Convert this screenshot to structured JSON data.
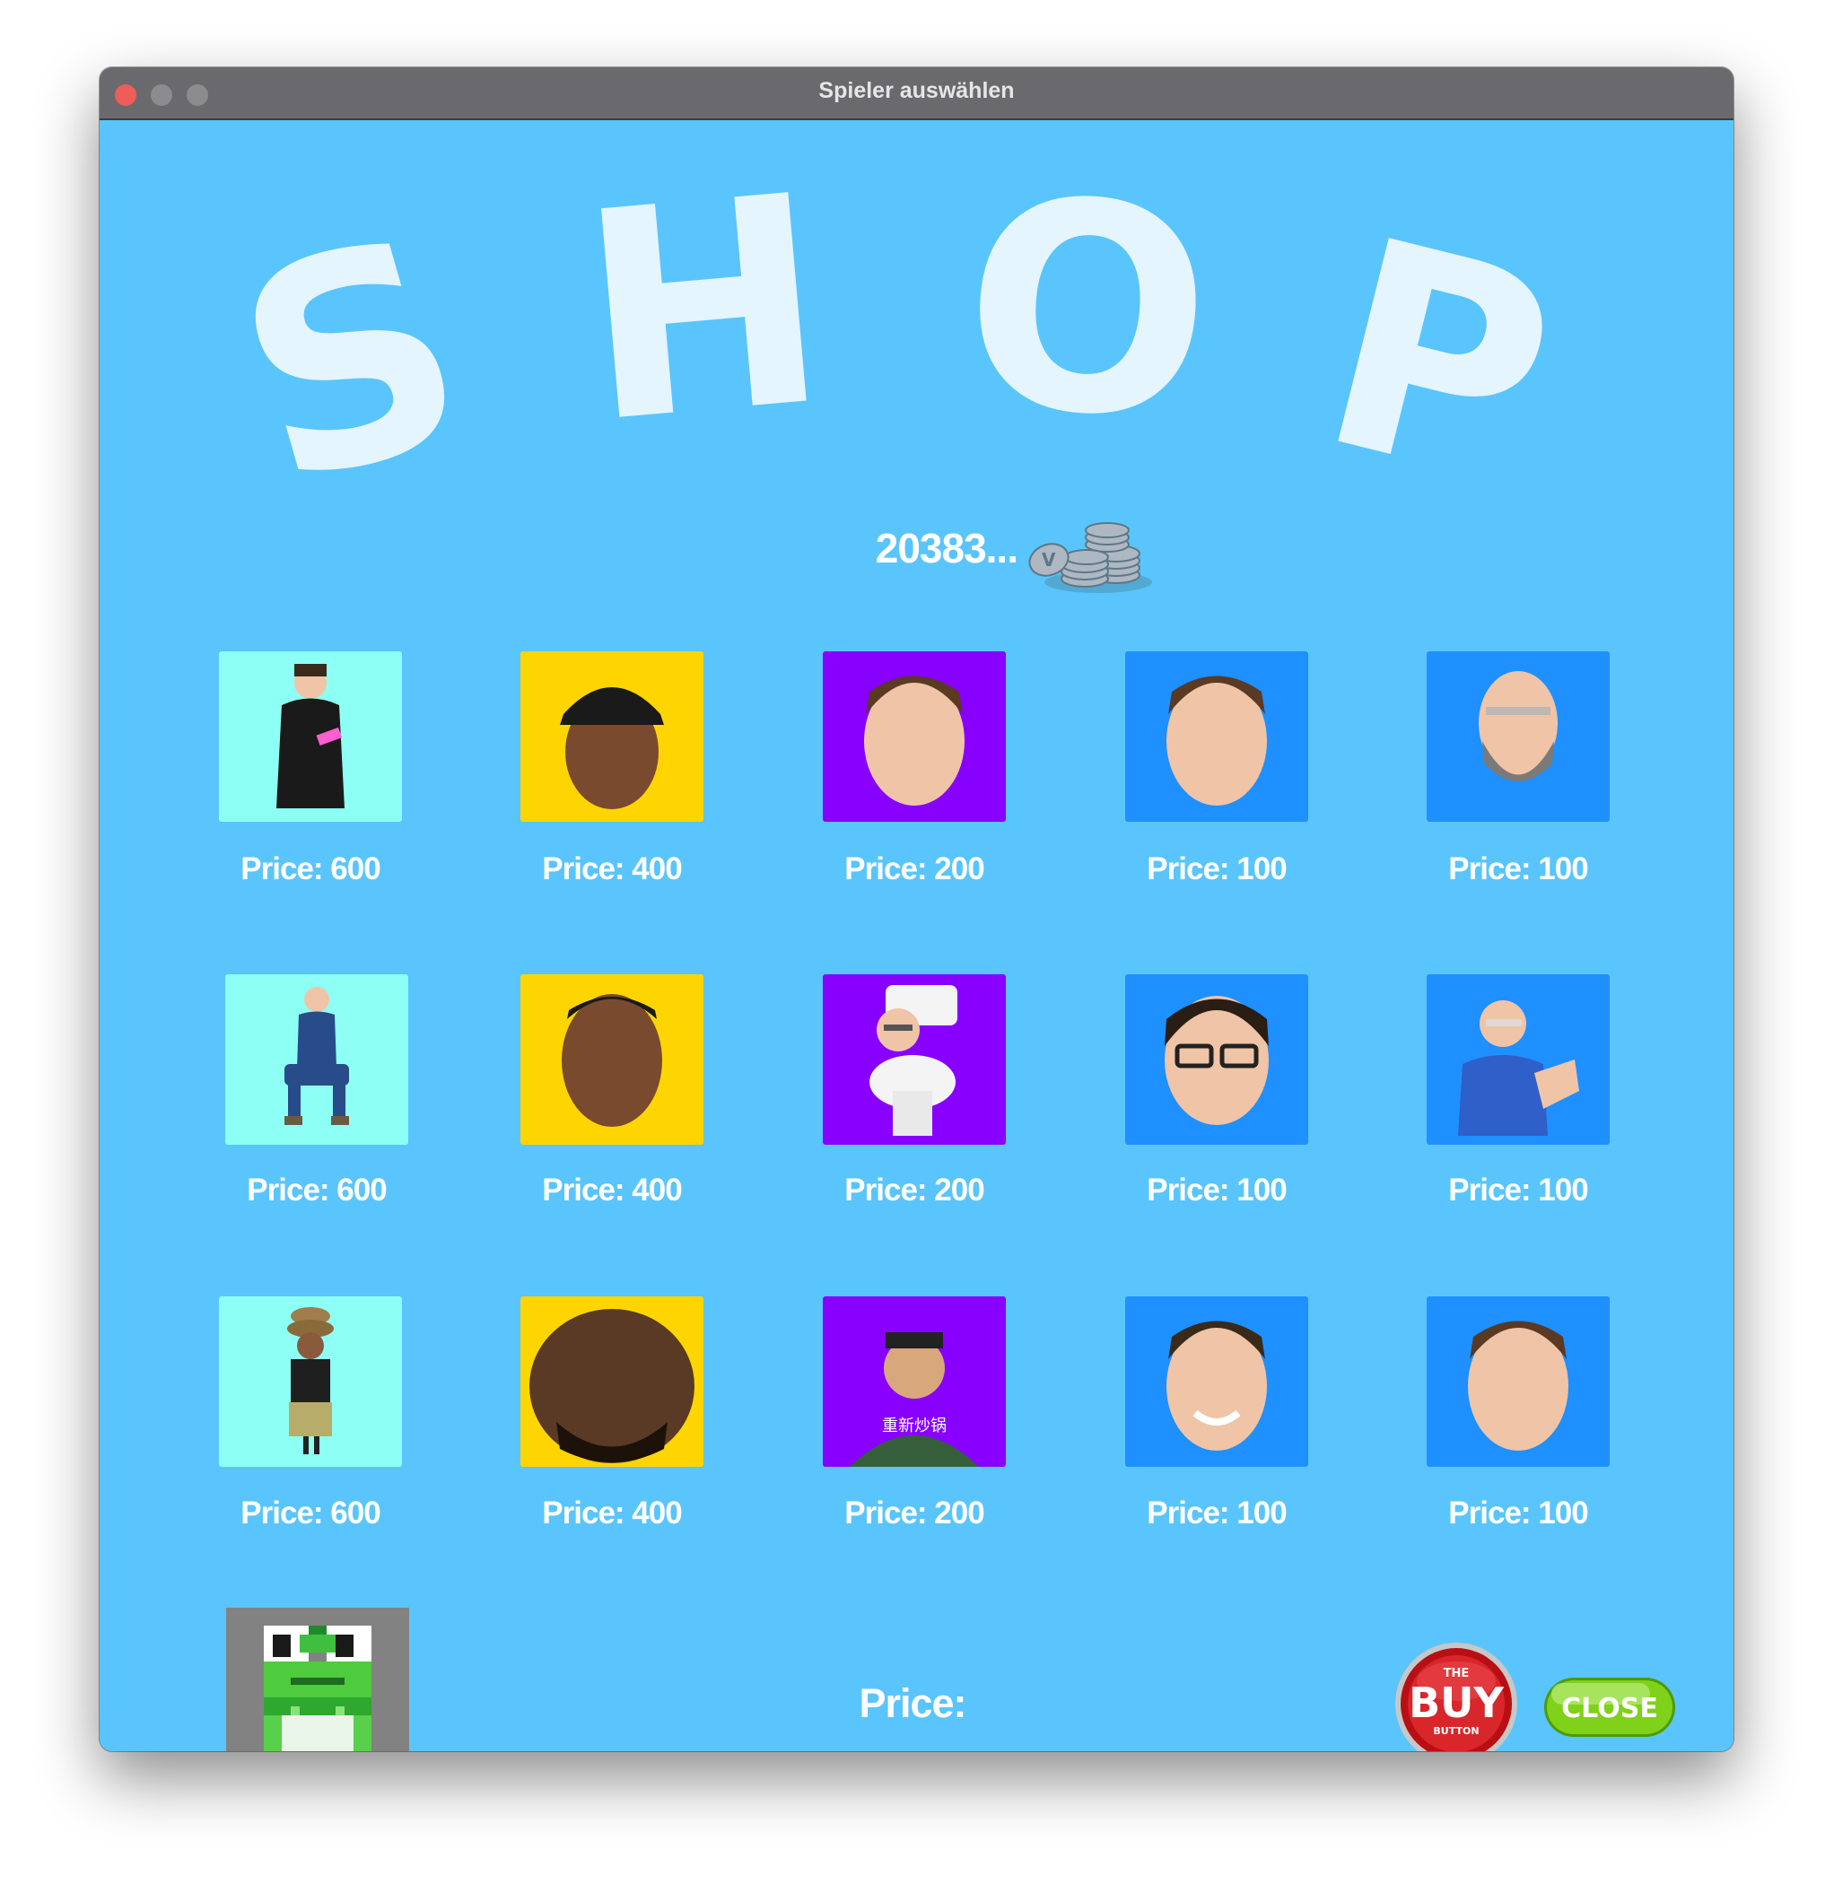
{
  "window": {
    "title": "Spieler auswählen"
  },
  "shop": {
    "letters": [
      "S",
      "H",
      "O",
      "P"
    ]
  },
  "balance": {
    "text": "20383...",
    "icon": "coin-stack-icon"
  },
  "rows": [
    [
      {
        "price": "Price: 600",
        "bg": "#8efff4",
        "figure": "person-body"
      },
      {
        "price": "Price: 400",
        "bg": "#ffd500",
        "figure": "face-dark-cap"
      },
      {
        "price": "Price: 200",
        "bg": "#8800ff",
        "figure": "face-light"
      },
      {
        "price": "Price: 100",
        "bg": "#1e90ff",
        "figure": "face-light"
      },
      {
        "price": "Price: 100",
        "bg": "#1e90ff",
        "figure": "face-bald-beard"
      }
    ],
    [
      {
        "price": "Price: 600",
        "bg": "#8efff4",
        "figure": "person-sitting"
      },
      {
        "price": "Price: 400",
        "bg": "#ffd500",
        "figure": "face-dark"
      },
      {
        "price": "Price: 200",
        "bg": "#8800ff",
        "figure": "toilet-head"
      },
      {
        "price": "Price: 100",
        "bg": "#1e90ff",
        "figure": "face-glasses"
      },
      {
        "price": "Price: 100",
        "bg": "#1e90ff",
        "figure": "person-scrubs"
      }
    ],
    [
      {
        "price": "Price: 600",
        "bg": "#8efff4",
        "figure": "person-hats"
      },
      {
        "price": "Price: 400",
        "bg": "#ffd500",
        "figure": "face-dark-large"
      },
      {
        "price": "Price: 200",
        "bg": "#8800ff",
        "figure": "portrait-caption",
        "caption": "重新炒锅"
      },
      {
        "price": "Price: 100",
        "bg": "#1e90ff",
        "figure": "face-light-smile"
      },
      {
        "price": "Price: 100",
        "bg": "#1e90ff",
        "figure": "face-light"
      }
    ]
  ],
  "selected": {
    "icon": "pixel-frog-icon",
    "bg": "#828282"
  },
  "footer": {
    "price_label": "Price:",
    "buy_button": {
      "small_top": "THE",
      "main": "BUY",
      "small_bottom": "BUTTON"
    },
    "close_button": "CLOSE"
  }
}
